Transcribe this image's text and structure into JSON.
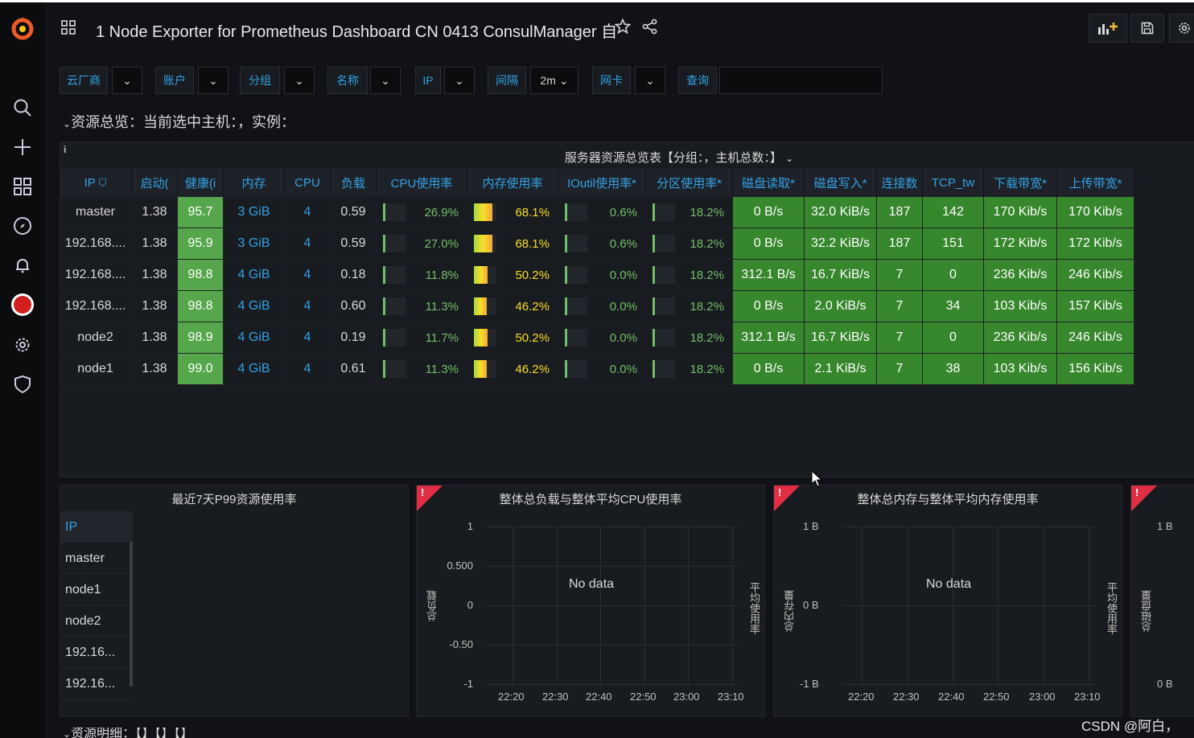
{
  "title": "1 Node Exporter for Prometheus Dashboard CN 0413 ConsulManager 自",
  "variables": {
    "cloud": "云厂商",
    "account": "账户",
    "group": "分组",
    "name": "名称",
    "ip": "IP",
    "interval": "间隔",
    "interval_value": "2m",
    "nic": "网卡",
    "query": "查询"
  },
  "row_title": "资源总览：当前选中主机：，实例：",
  "row_title2": "资源明细：【】【】【】",
  "table": {
    "title": "服务器资源总览表【分组：，主机总数：】",
    "headers": [
      "IP",
      "启动(",
      "健康(i",
      "内存",
      "CPU",
      "负载",
      "CPU使用率",
      "内存使用率",
      "IOutil使用率*",
      "分区使用率*",
      "磁盘读取*",
      "磁盘写入*",
      "连接数",
      "TCP_tw",
      "下载带宽*",
      "上传带宽*"
    ],
    "rows": [
      {
        "ip": "master",
        "up": "1.38",
        "health": "95.7",
        "mem": "3 GiB",
        "cpu": "4",
        "load": "0.59",
        "cpu_pct": "26.9%",
        "cpu_v": 0.269,
        "mem_pct": "68.1%",
        "mem_v": 0.681,
        "io_pct": "0.6%",
        "io_v": 0.006,
        "part_pct": "18.2%",
        "part_v": 0.182,
        "dr": "0 B/s",
        "dw": "32.0 KiB/s",
        "conn": "187",
        "tcp": "142",
        "down": "170 Kib/s",
        "upl": "170 Kib/s"
      },
      {
        "ip": "192.168....",
        "up": "1.38",
        "health": "95.9",
        "mem": "3 GiB",
        "cpu": "4",
        "load": "0.59",
        "cpu_pct": "27.0%",
        "cpu_v": 0.27,
        "mem_pct": "68.1%",
        "mem_v": 0.681,
        "io_pct": "0.6%",
        "io_v": 0.006,
        "part_pct": "18.2%",
        "part_v": 0.182,
        "dr": "0 B/s",
        "dw": "32.2 KiB/s",
        "conn": "187",
        "tcp": "151",
        "down": "172 Kib/s",
        "upl": "172 Kib/s"
      },
      {
        "ip": "192.168....",
        "up": "1.38",
        "health": "98.8",
        "mem": "4 GiB",
        "cpu": "4",
        "load": "0.18",
        "cpu_pct": "11.8%",
        "cpu_v": 0.118,
        "mem_pct": "50.2%",
        "mem_v": 0.502,
        "io_pct": "0.0%",
        "io_v": 0,
        "part_pct": "18.2%",
        "part_v": 0.182,
        "dr": "312.1 B/s",
        "dw": "16.7 KiB/s",
        "conn": "7",
        "tcp": "0",
        "down": "236 Kib/s",
        "upl": "246 Kib/s"
      },
      {
        "ip": "192.168....",
        "up": "1.38",
        "health": "98.8",
        "mem": "4 GiB",
        "cpu": "4",
        "load": "0.60",
        "cpu_pct": "11.3%",
        "cpu_v": 0.113,
        "mem_pct": "46.2%",
        "mem_v": 0.462,
        "io_pct": "0.0%",
        "io_v": 0,
        "part_pct": "18.2%",
        "part_v": 0.182,
        "dr": "0 B/s",
        "dw": "2.0 KiB/s",
        "conn": "7",
        "tcp": "34",
        "down": "103 Kib/s",
        "upl": "157 Kib/s"
      },
      {
        "ip": "node2",
        "up": "1.38",
        "health": "98.9",
        "mem": "4 GiB",
        "cpu": "4",
        "load": "0.19",
        "cpu_pct": "11.7%",
        "cpu_v": 0.117,
        "mem_pct": "50.2%",
        "mem_v": 0.502,
        "io_pct": "0.0%",
        "io_v": 0,
        "part_pct": "18.2%",
        "part_v": 0.182,
        "dr": "312.1 B/s",
        "dw": "16.7 KiB/s",
        "conn": "7",
        "tcp": "0",
        "down": "236 Kib/s",
        "upl": "246 Kib/s"
      },
      {
        "ip": "node1",
        "up": "1.38",
        "health": "99.0",
        "mem": "4 GiB",
        "cpu": "4",
        "load": "0.61",
        "cpu_pct": "11.3%",
        "cpu_v": 0.113,
        "mem_pct": "46.2%",
        "mem_v": 0.462,
        "io_pct": "0.0%",
        "io_v": 0,
        "part_pct": "18.2%",
        "part_v": 0.182,
        "dr": "0 B/s",
        "dw": "2.1 KiB/s",
        "conn": "7",
        "tcp": "38",
        "down": "103 Kib/s",
        "upl": "156 Kib/s"
      }
    ]
  },
  "p99": {
    "title": "最近7天P99资源使用率",
    "header": "IP",
    "items": [
      "master",
      "node1",
      "node2",
      "192.16...",
      "192.16..."
    ]
  },
  "chart_data": [
    {
      "type": "line",
      "title": "整体总负载与整体平均CPU使用率",
      "no_data": "No data",
      "yticks": [
        "1",
        "0.500",
        "0",
        "-0.50",
        "-1"
      ],
      "xticks": [
        "22:20",
        "22:30",
        "22:40",
        "22:50",
        "23:00",
        "23:10"
      ],
      "ylabel": "总负载",
      "y2label": "平均使用率",
      "series": []
    },
    {
      "type": "line",
      "title": "整体总内存与整体平均内存使用率",
      "no_data": "No data",
      "yticks": [
        "1 B",
        "0 B",
        "-1 B"
      ],
      "xticks": [
        "22:20",
        "22:30",
        "22:40",
        "22:50",
        "23:00",
        "23:10"
      ],
      "ylabel": "总内存量",
      "y2label": "平均使用率",
      "series": []
    },
    {
      "type": "line",
      "title": "",
      "yticks": [
        "1 B",
        "0 B"
      ],
      "ylabel": "总磁盘量",
      "series": []
    }
  ],
  "watermark": "CSDN @阿白，",
  "colors": {
    "accent": "#33a2e5",
    "green": "#56a64b",
    "dark_green": "#37872d",
    "red": "#e02f44"
  }
}
